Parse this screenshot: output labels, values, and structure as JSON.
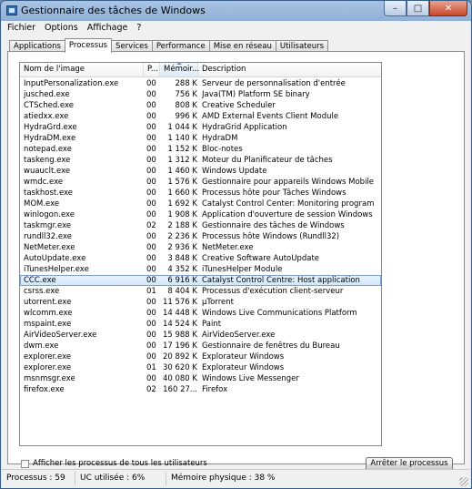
{
  "window": {
    "title": "Gestionnaire des tâches de Windows",
    "minimize": "–",
    "maximize": "□",
    "close": "✕"
  },
  "menu": [
    "Fichier",
    "Options",
    "Affichage",
    "?"
  ],
  "tabs": [
    "Applications",
    "Processus",
    "Services",
    "Performance",
    "Mise en réseau",
    "Utilisateurs"
  ],
  "active_tab": "Processus",
  "columns": {
    "name": "Nom de l'image",
    "user": "P...",
    "memory": "Mémoir...",
    "description": "Description"
  },
  "processes": [
    {
      "name": "InputPersonalization.exe",
      "user": "00",
      "memory": "288 K",
      "description": "Serveur de personnalisation d'entrée"
    },
    {
      "name": "jusched.exe",
      "user": "00",
      "memory": "756 K",
      "description": "Java(TM) Platform SE binary"
    },
    {
      "name": "CTSched.exe",
      "user": "00",
      "memory": "808 K",
      "description": "Creative Scheduler"
    },
    {
      "name": "atiedxx.exe",
      "user": "00",
      "memory": "996 K",
      "description": "AMD External Events Client Module"
    },
    {
      "name": "HydraGrd.exe",
      "user": "00",
      "memory": "1 044 K",
      "description": "HydraGrid Application"
    },
    {
      "name": "HydraDM.exe",
      "user": "00",
      "memory": "1 140 K",
      "description": "HydraDM"
    },
    {
      "name": "notepad.exe",
      "user": "00",
      "memory": "1 152 K",
      "description": "Bloc-notes"
    },
    {
      "name": "taskeng.exe",
      "user": "00",
      "memory": "1 312 K",
      "description": "Moteur du Planificateur de tâches"
    },
    {
      "name": "wuauclt.exe",
      "user": "00",
      "memory": "1 460 K",
      "description": "Windows Update"
    },
    {
      "name": "wmdc.exe",
      "user": "00",
      "memory": "1 576 K",
      "description": "Gestionnaire pour appareils Windows Mobile"
    },
    {
      "name": "taskhost.exe",
      "user": "00",
      "memory": "1 660 K",
      "description": "Processus hôte pour Tâches Windows"
    },
    {
      "name": "MOM.exe",
      "user": "00",
      "memory": "1 692 K",
      "description": "Catalyst Control Center: Monitoring program"
    },
    {
      "name": "winlogon.exe",
      "user": "00",
      "memory": "1 908 K",
      "description": "Application d'ouverture de session Windows"
    },
    {
      "name": "taskmgr.exe",
      "user": "02",
      "memory": "2 188 K",
      "description": "Gestionnaire des tâches de Windows"
    },
    {
      "name": "rundll32.exe",
      "user": "00",
      "memory": "2 236 K",
      "description": "Processus hôte Windows (Rundll32)"
    },
    {
      "name": "NetMeter.exe",
      "user": "00",
      "memory": "2 936 K",
      "description": "NetMeter.exe"
    },
    {
      "name": "AutoUpdate.exe",
      "user": "00",
      "memory": "3 848 K",
      "description": "Creative Software AutoUpdate"
    },
    {
      "name": "iTunesHelper.exe",
      "user": "00",
      "memory": "4 352 K",
      "description": "iTunesHelper Module"
    },
    {
      "name": "CCC.exe",
      "user": "00",
      "memory": "6 916 K",
      "description": "Catalyst Control Centre: Host application",
      "selected": true
    },
    {
      "name": "csrss.exe",
      "user": "01",
      "memory": "8 404 K",
      "description": "Processus d'exécution client-serveur"
    },
    {
      "name": "utorrent.exe",
      "user": "00",
      "memory": "11 576 K",
      "description": "µTorrent"
    },
    {
      "name": "wlcomm.exe",
      "user": "00",
      "memory": "14 448 K",
      "description": "Windows Live Communications Platform"
    },
    {
      "name": "mspaint.exe",
      "user": "00",
      "memory": "14 524 K",
      "description": "Paint"
    },
    {
      "name": "AirVideoServer.exe",
      "user": "00",
      "memory": "15 988 K",
      "description": "AirVideoServer.exe"
    },
    {
      "name": "dwm.exe",
      "user": "00",
      "memory": "17 196 K",
      "description": "Gestionnaire de fenêtres du Bureau"
    },
    {
      "name": "explorer.exe",
      "user": "00",
      "memory": "20 892 K",
      "description": "Explorateur Windows"
    },
    {
      "name": "explorer.exe",
      "user": "01",
      "memory": "30 620 K",
      "description": "Explorateur Windows"
    },
    {
      "name": "msnmsgr.exe",
      "user": "00",
      "memory": "40 080 K",
      "description": "Windows Live Messenger"
    },
    {
      "name": "firefox.exe",
      "user": "02",
      "memory": "160 27...",
      "description": "Firefox"
    }
  ],
  "show_all_users_label": "Afficher les processus de tous les utilisateurs",
  "end_process_label": "Arrêter le processus",
  "status": {
    "processes": "Processus : 59",
    "cpu": "UC utilisée : 6%",
    "memory": "Mémoire physique : 38 %"
  }
}
